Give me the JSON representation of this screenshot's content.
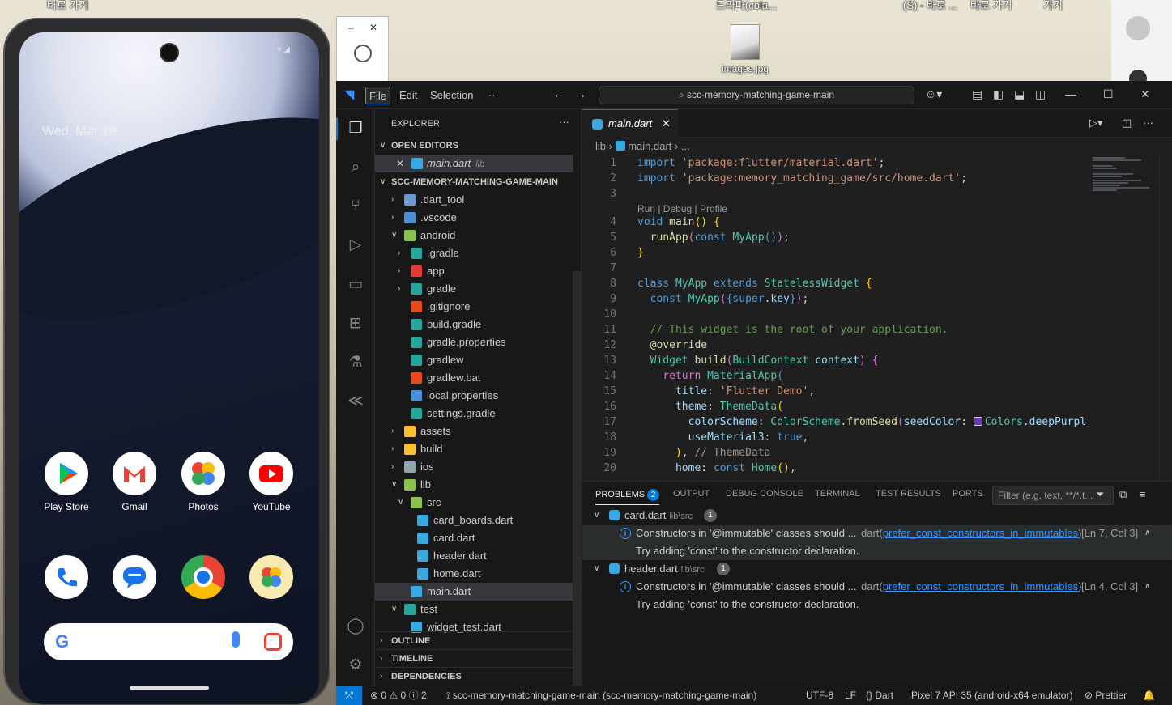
{
  "desktop": {
    "top_labels": [
      "바로 가기",
      "드라마(cola...",
      "(S) - 바로 ...",
      "바로 가기",
      "가기"
    ],
    "file_icon_label": "images.jpg"
  },
  "phone": {
    "time": "12:14",
    "date": "Wed, Mar 19",
    "apps_row1": [
      "Play Store",
      "Gmail",
      "Photos",
      "YouTube"
    ],
    "search_logo": "G"
  },
  "vscode": {
    "menus": [
      "File",
      "Edit",
      "Selection",
      "···"
    ],
    "command_center": "scc-memory-matching-game-main",
    "explorer": {
      "title": "EXPLORER",
      "open_editors_label": "OPEN EDITORS",
      "open_editor": {
        "name": "main.dart",
        "dir": "lib"
      },
      "root_label": "SCC-MEMORY-MATCHING-GAME-MAIN",
      "tree": [
        {
          "name": ".dart_tool",
          "depth": 0,
          "folder": true,
          "open": false,
          "color": "#6b9bd2"
        },
        {
          "name": ".vscode",
          "depth": 0,
          "folder": true,
          "open": false,
          "color": "#4a90d9"
        },
        {
          "name": "android",
          "depth": 0,
          "folder": true,
          "open": true,
          "color": "#8bc34a"
        },
        {
          "name": ".gradle",
          "depth": 1,
          "folder": true,
          "open": false,
          "color": "#26a69a"
        },
        {
          "name": "app",
          "depth": 1,
          "folder": true,
          "open": false,
          "color": "#e53935"
        },
        {
          "name": "gradle",
          "depth": 1,
          "folder": true,
          "open": false,
          "color": "#26a69a"
        },
        {
          "name": ".gitignore",
          "depth": 1,
          "folder": false,
          "color": "#e64a19"
        },
        {
          "name": "build.gradle",
          "depth": 1,
          "folder": false,
          "color": "#26a69a"
        },
        {
          "name": "gradle.properties",
          "depth": 1,
          "folder": false,
          "color": "#26a69a"
        },
        {
          "name": "gradlew",
          "depth": 1,
          "folder": false,
          "color": "#26a69a"
        },
        {
          "name": "gradlew.bat",
          "depth": 1,
          "folder": false,
          "color": "#e64a19"
        },
        {
          "name": "local.properties",
          "depth": 1,
          "folder": false,
          "color": "#4a90d9"
        },
        {
          "name": "settings.gradle",
          "depth": 1,
          "folder": false,
          "color": "#26a69a"
        },
        {
          "name": "assets",
          "depth": 0,
          "folder": true,
          "open": false,
          "color": "#fbc02d"
        },
        {
          "name": "build",
          "depth": 0,
          "folder": true,
          "open": false,
          "color": "#fbc02d"
        },
        {
          "name": "ios",
          "depth": 0,
          "folder": true,
          "open": false,
          "color": "#90a4ae"
        },
        {
          "name": "lib",
          "depth": 0,
          "folder": true,
          "open": true,
          "color": "#8bc34a"
        },
        {
          "name": "src",
          "depth": 1,
          "folder": true,
          "open": true,
          "color": "#8bc34a"
        },
        {
          "name": "card_boards.dart",
          "depth": 2,
          "folder": false,
          "color": "#39a8e0"
        },
        {
          "name": "card.dart",
          "depth": 2,
          "folder": false,
          "color": "#39a8e0"
        },
        {
          "name": "header.dart",
          "depth": 2,
          "folder": false,
          "color": "#39a8e0"
        },
        {
          "name": "home.dart",
          "depth": 2,
          "folder": false,
          "color": "#39a8e0"
        },
        {
          "name": "main.dart",
          "depth": 1,
          "folder": false,
          "color": "#39a8e0",
          "selected": true
        },
        {
          "name": "test",
          "depth": 0,
          "folder": true,
          "open": true,
          "color": "#26a69a"
        },
        {
          "name": "widget_test.dart",
          "depth": 1,
          "folder": false,
          "color": "#39a8e0"
        }
      ],
      "outline_label": "OUTLINE",
      "timeline_label": "TIMELINE",
      "dependencies_label": "DEPENDENCIES"
    },
    "tab": {
      "name": "main.dart"
    },
    "breadcrumb": [
      "lib",
      "main.dart",
      "..."
    ],
    "code": {
      "codelens": "Run | Debug | Profile",
      "line_numbers": [
        "1",
        "2",
        "3",
        "4",
        "5",
        "6",
        "7",
        "8",
        "9",
        "10",
        "11",
        "12",
        "13",
        "14",
        "15",
        "16",
        "17",
        "18",
        "19",
        "20"
      ]
    },
    "panel": {
      "tabs": [
        "PROBLEMS",
        "OUTPUT",
        "DEBUG CONSOLE",
        "TERMINAL",
        "TEST RESULTS",
        "PORTS"
      ],
      "problems_count": "2",
      "filter_placeholder": "Filter (e.g. text, **/*.t...",
      "groups": [
        {
          "file": "card.dart",
          "dir": "lib\\src",
          "count": "1",
          "message": "Constructors in '@immutable' classes should ...",
          "source": "dart",
          "rule": "prefer_const_constructors_in_immutables",
          "location": "[Ln 7, Col 3]",
          "hint": "Try adding 'const' to the constructor declaration."
        },
        {
          "file": "header.dart",
          "dir": "lib\\src",
          "count": "1",
          "message": "Constructors in '@immutable' classes should ...",
          "source": "dart",
          "rule": "prefer_const_constructors_in_immutables",
          "location": "[Ln 4, Col 3]",
          "hint": "Try adding 'const' to the constructor declaration."
        }
      ]
    },
    "status": {
      "errors": "0",
      "warnings": "0",
      "infos": "2",
      "project": "scc-memory-matching-game-main (scc-memory-matching-game-main)",
      "encoding": "UTF-8",
      "eol": "LF",
      "language": "Dart",
      "device": "Pixel 7 API 35 (android-x64 emulator)",
      "formatter": "Prettier"
    }
  }
}
